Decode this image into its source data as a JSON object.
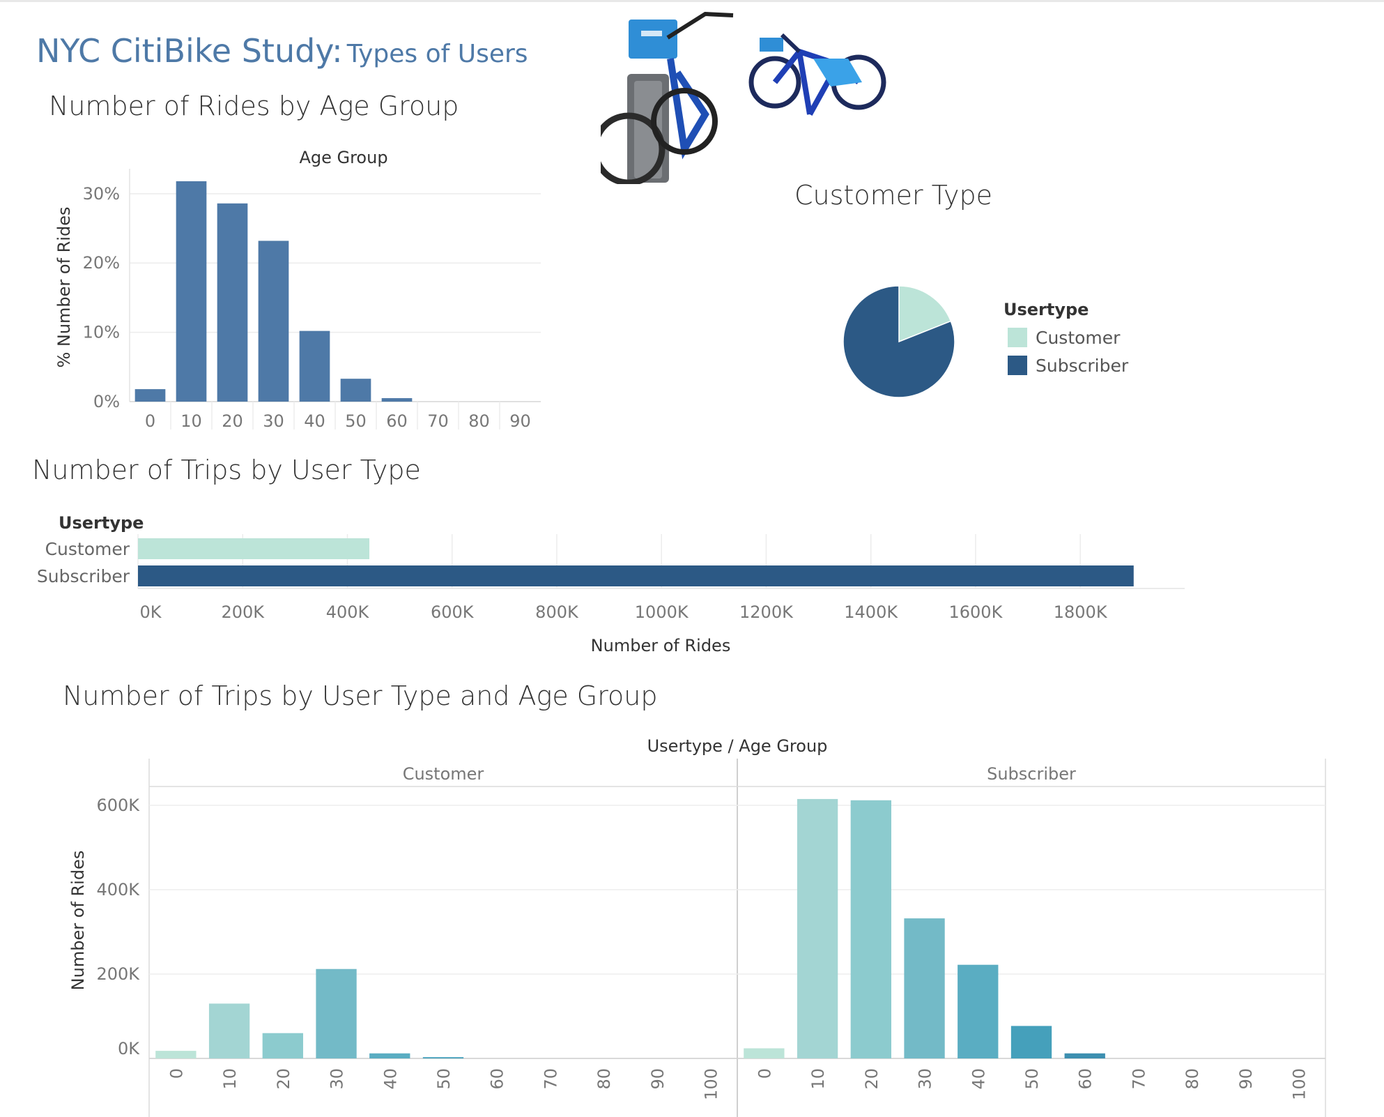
{
  "header": {
    "title_main": "NYC CitiBike Study:",
    "title_sub": "Types of Users"
  },
  "colors": {
    "title": "#4e79a7",
    "age_bar": "#4e79a7",
    "customer": "#bce4d8",
    "subscriber": "#2c5985",
    "facet_bars": [
      "#bce4d8",
      "#a3d5d3",
      "#8ccbce",
      "#73bac7",
      "#5aadc2",
      "#45a0bb",
      "#3d8fb0",
      "#357fa4"
    ]
  },
  "chart_data": [
    {
      "id": "age_chart",
      "type": "bar",
      "title": "Number of Rides by Age Group",
      "xlabel": "Age Group",
      "ylabel": "% Number of Rides",
      "categories": [
        "0",
        "10",
        "20",
        "30",
        "40",
        "50",
        "60",
        "70",
        "80",
        "90"
      ],
      "values": [
        1.8,
        31.8,
        28.6,
        23.2,
        10.2,
        3.3,
        0.5,
        0,
        0,
        0
      ],
      "yticks": [
        "0%",
        "10%",
        "20%",
        "30%"
      ],
      "ylim": [
        0,
        33
      ],
      "grid": true
    },
    {
      "id": "pie_chart",
      "type": "pie",
      "title": "Customer Type",
      "legend_title": "Usertype",
      "legend_position": "right",
      "categories": [
        "Customer",
        "Subscriber"
      ],
      "values": [
        0.19,
        0.81
      ]
    },
    {
      "id": "hbar_chart",
      "type": "bar",
      "orientation": "horizontal",
      "title": "Number of Trips by User Type",
      "row_header": "Usertype",
      "xlabel": "Number of Rides",
      "categories": [
        "Customer",
        "Subscriber"
      ],
      "values": [
        442000,
        1902000
      ],
      "xticks": [
        "0K",
        "200K",
        "400K",
        "600K",
        "800K",
        "1000K",
        "1200K",
        "1400K",
        "1600K",
        "1800K"
      ],
      "xlim": [
        0,
        2000000
      ],
      "grid": true
    },
    {
      "id": "facet_chart",
      "type": "bar",
      "title": "Number of Trips by User Type and Age Group",
      "header_label": "Usertype",
      "header_sep": "/",
      "header_label2": "Age Group",
      "ylabel": "Number of Rides",
      "categories": [
        "0",
        "10",
        "20",
        "30",
        "40",
        "50",
        "60",
        "70",
        "80",
        "90",
        "100"
      ],
      "yticks": [
        "0K",
        "200K",
        "400K",
        "600K"
      ],
      "ylim": [
        0,
        650000
      ],
      "series": [
        {
          "name": "Customer",
          "values": [
            18000,
            130000,
            60000,
            212000,
            12000,
            3000,
            0,
            0,
            0,
            0,
            0
          ]
        },
        {
          "name": "Subscriber",
          "values": [
            24000,
            615000,
            612000,
            332000,
            222000,
            77000,
            12000,
            0,
            0,
            0,
            0
          ]
        }
      ]
    }
  ]
}
